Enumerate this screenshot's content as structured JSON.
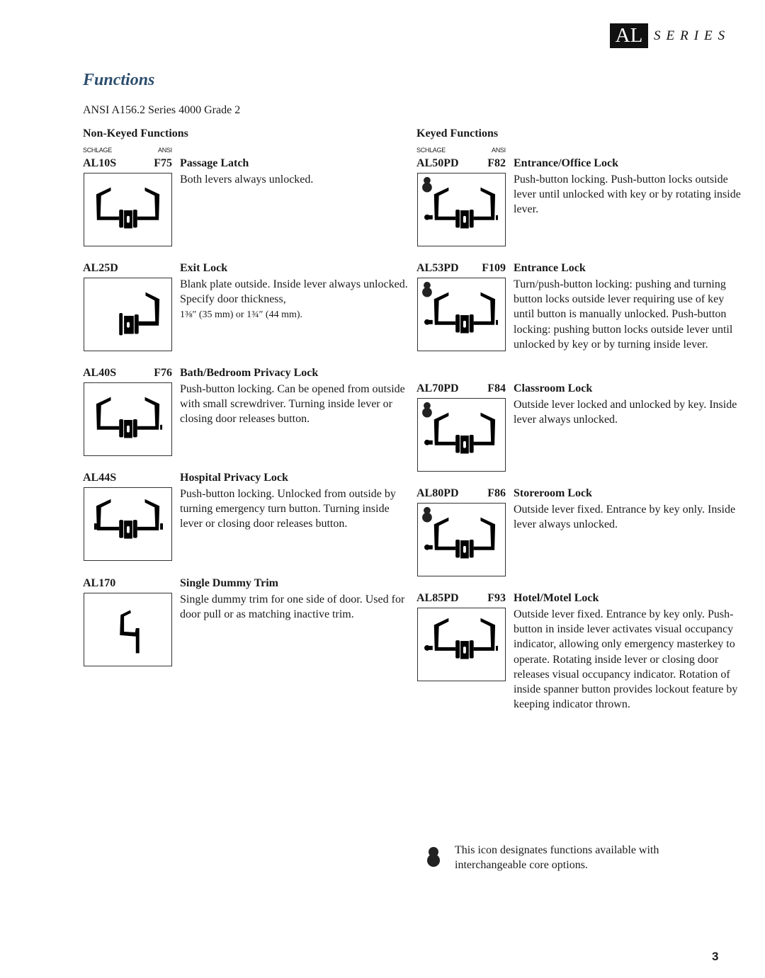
{
  "header": {
    "badge": "AL",
    "series": "SERIES"
  },
  "page_title": "Functions",
  "subtitle": "ANSI A156.2 Series 4000 Grade 2",
  "columns": {
    "non_keyed": {
      "heading": "Non-Keyed Functions",
      "schlage_label": "SCHLAGE",
      "ansi_label": "ANSI",
      "entries": [
        {
          "code": "AL10S",
          "ansi": "F75",
          "name": "Passage Latch",
          "description": "Both levers always unlocked.",
          "diagram": "passage-latch"
        },
        {
          "code": "AL25D",
          "ansi": "",
          "name": "Exit Lock",
          "description": "Blank plate outside. Inside lever always unlocked. Specify door thickness,",
          "description_extra": "1⅜″ (35 mm) or 1¾″ (44 mm).",
          "diagram": "exit-lock"
        },
        {
          "code": "AL40S",
          "ansi": "F76",
          "name": "Bath/Bedroom Privacy Lock",
          "description": "Push-button locking. Can be opened from outside with small screwdriver. Turning inside lever or closing door releases button.",
          "diagram": "privacy-lock"
        },
        {
          "code": "AL44S",
          "ansi": "",
          "name": "Hospital Privacy Lock",
          "description": "Push-button locking. Unlocked from outside by turning emergency turn button. Turning inside lever or closing door releases button.",
          "diagram": "hospital-privacy-lock"
        },
        {
          "code": "AL170",
          "ansi": "",
          "name": "Single Dummy Trim",
          "description": "Single dummy trim for one side of door. Used for door pull or as matching inactive trim.",
          "diagram": "dummy-trim"
        }
      ]
    },
    "keyed": {
      "heading": "Keyed Functions",
      "schlage_label": "SCHLAGE",
      "ansi_label": "ANSI",
      "entries": [
        {
          "code": "AL50PD",
          "ansi": "F82",
          "name": "Entrance/Office Lock",
          "description": "Push-button locking. Push-button locks outside lever until unlocked with key or by rotating inside lever.",
          "interchangeable_core": true
        },
        {
          "code": "AL53PD",
          "ansi": "F109",
          "name": "Entrance Lock",
          "description": "Turn/push-button locking: pushing and turning button locks outside lever requiring use of key until button is manually unlocked. Push-button locking: pushing button locks outside lever until unlocked by key or by turning inside lever.",
          "interchangeable_core": true
        },
        {
          "code": "AL70PD",
          "ansi": "F84",
          "name": "Classroom Lock",
          "description": "Outside lever locked and unlocked by key. Inside lever always unlocked.",
          "interchangeable_core": true
        },
        {
          "code": "AL80PD",
          "ansi": "F86",
          "name": "Storeroom Lock",
          "description": "Outside lever fixed. Entrance by key only. Inside lever always unlocked.",
          "interchangeable_core": true
        },
        {
          "code": "AL85PD",
          "ansi": "F93",
          "name": "Hotel/Motel Lock",
          "description": "Outside lever fixed. Entrance by key only. Push-button in inside lever activates visual occupancy indicator, allowing only emergency masterkey to operate. Rotating inside lever or closing door releases visual occupancy indicator. Rotation of inside spanner button provides lockout feature by keeping indicator thrown.",
          "interchangeable_core": false
        }
      ]
    }
  },
  "legend": {
    "icon": "interchangeable-core-icon",
    "text": "This icon designates functions available with interchangeable core options."
  },
  "page_number": "3"
}
